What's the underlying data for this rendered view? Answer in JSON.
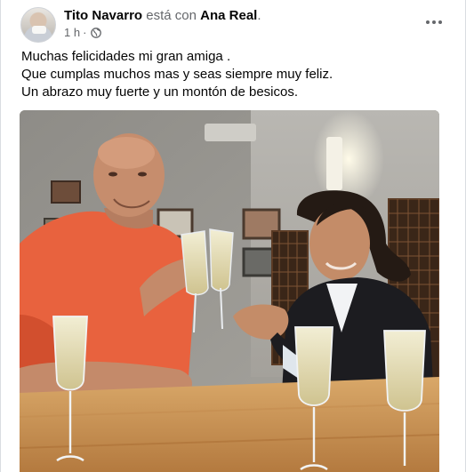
{
  "post": {
    "author": "Tito Navarro",
    "with_text": "está con",
    "tagged": "Ana Real",
    "tag_end": ".",
    "time": "1 h",
    "separator": "·",
    "audience_icon": "globe-icon",
    "more_icon": "more-horizontal-icon",
    "text_lines": [
      "Muchas felicidades mi gran amiga  .",
      "Que cumplas muchos mas y seas siempre muy feliz.",
      "Un abrazo muy fuerte y un montón de besicos."
    ],
    "photo_subject": "photo of two people toasting with champagne flutes"
  },
  "colors": {
    "primary_text": "#050505",
    "secondary_text": "#65676b",
    "card_background": "#ffffff"
  }
}
